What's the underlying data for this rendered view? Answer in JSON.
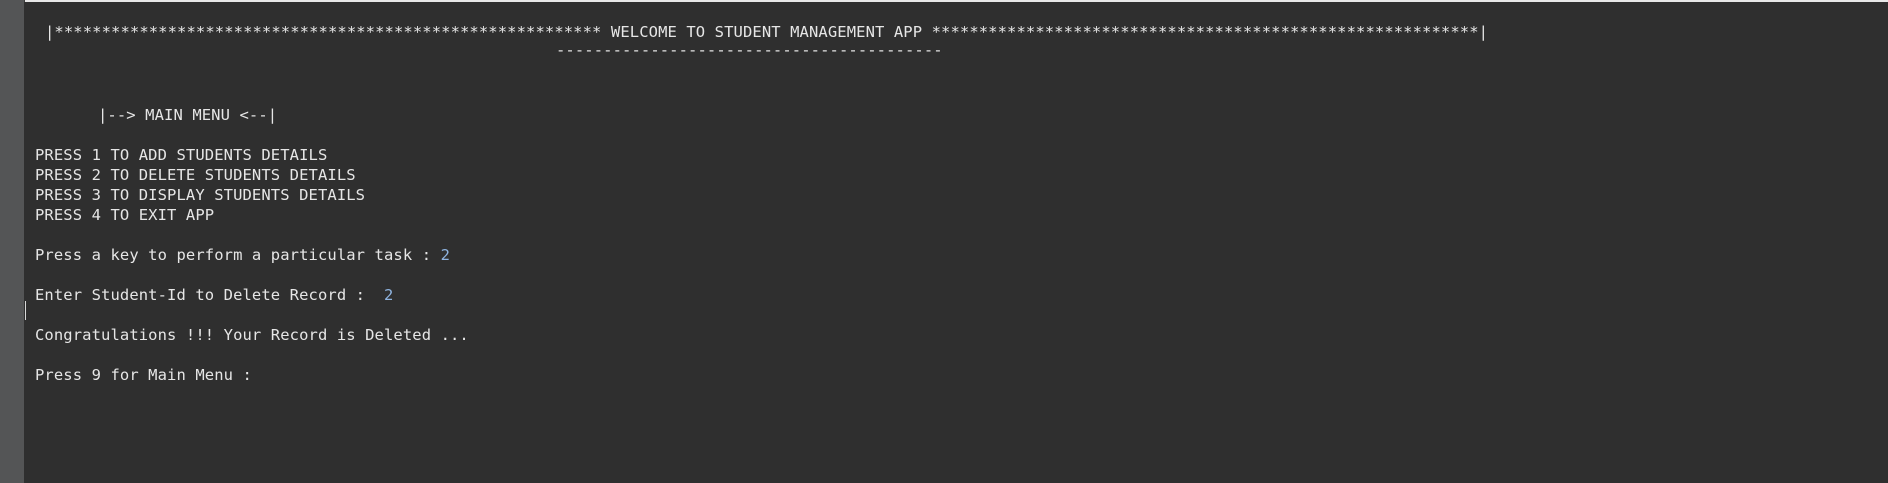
{
  "console": {
    "banner": "|********************************************************** WELCOME TO STUDENT MANAGEMENT APP **********************************************************|",
    "banner_underline": "-----------------------------------------",
    "menu_heading": "|--> MAIN MENU <--|",
    "options": [
      "PRESS 1 TO ADD STUDENTS DETAILS",
      "PRESS 2 TO DELETE STUDENTS DETAILS",
      "PRESS 3 TO DISPLAY STUDENTS DETAILS",
      "PRESS 4 TO EXIT APP"
    ],
    "task_prompt": "Press a key to perform a particular task : ",
    "task_input": "2",
    "delete_prompt": "Enter Student-Id to Delete Record :  ",
    "delete_input": "2",
    "success_message": "Congratulations !!! Your Record is Deleted ...",
    "main_menu_prompt": "Press 9 for Main Menu : "
  },
  "colors": {
    "background": "#2f2f2f",
    "text": "#e6e6e6",
    "input_text": "#8fb4e0",
    "gutter": "#545556"
  }
}
